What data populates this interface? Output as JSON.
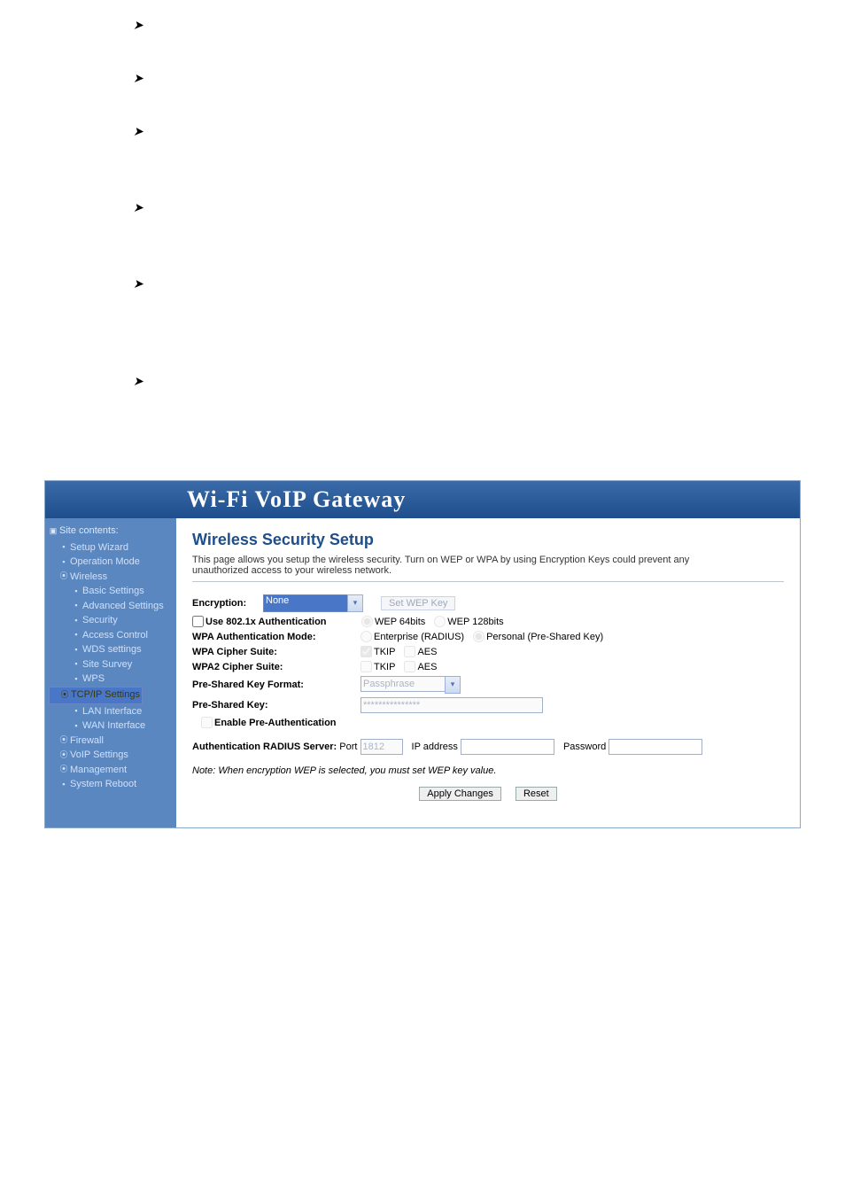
{
  "header": {
    "title": "Wi-Fi  VoIP  Gateway"
  },
  "sidebar": {
    "root": "Site contents:",
    "items": [
      {
        "label": "Setup Wizard",
        "type": "page",
        "lvl": 2
      },
      {
        "label": "Operation Mode",
        "type": "page",
        "lvl": 2
      },
      {
        "label": "Wireless",
        "type": "folder",
        "lvl": 2
      },
      {
        "label": "Basic Settings",
        "type": "page",
        "lvl": 3
      },
      {
        "label": "Advanced Settings",
        "type": "page",
        "lvl": 3
      },
      {
        "label": "Security",
        "type": "page",
        "lvl": 3
      },
      {
        "label": "Access Control",
        "type": "page",
        "lvl": 3
      },
      {
        "label": "WDS settings",
        "type": "page",
        "lvl": 3
      },
      {
        "label": "Site Survey",
        "type": "page",
        "lvl": 3
      },
      {
        "label": "WPS",
        "type": "page",
        "lvl": 3
      },
      {
        "label": "TCP/IP Settings",
        "type": "folder",
        "lvl": 2,
        "sel": true
      },
      {
        "label": "LAN Interface",
        "type": "page",
        "lvl": 3
      },
      {
        "label": "WAN Interface",
        "type": "page",
        "lvl": 3
      },
      {
        "label": "Firewall",
        "type": "folder",
        "lvl": 2
      },
      {
        "label": "VoIP Settings",
        "type": "folder",
        "lvl": 2
      },
      {
        "label": "Management",
        "type": "folder",
        "lvl": 2
      },
      {
        "label": "System Reboot",
        "type": "page",
        "lvl": 2
      }
    ]
  },
  "content": {
    "title": "Wireless Security Setup",
    "desc": "This page allows you setup the wireless security. Turn on WEP or WPA by using Encryption Keys could prevent any unauthorized access to your wireless network.",
    "encryption_label": "Encryption:",
    "encryption_value": "None",
    "set_wep_btn": "Set WEP Key",
    "use8021x_label": "Use 802.1x Authentication",
    "wep64_label": "WEP 64bits",
    "wep128_label": "WEP 128bits",
    "wpa_auth_label": "WPA Authentication Mode:",
    "enterprise_label": "Enterprise (RADIUS)",
    "personal_label": "Personal (Pre-Shared Key)",
    "wpa_cipher_label": "WPA Cipher Suite:",
    "wpa2_cipher_label": "WPA2 Cipher Suite:",
    "tkip_label": "TKIP",
    "aes_label": "AES",
    "psk_format_label": "Pre-Shared Key Format:",
    "psk_format_value": "Passphrase",
    "psk_label": "Pre-Shared Key:",
    "psk_value": "***************",
    "preauth_label": "Enable Pre-Authentication",
    "radius_label": "Authentication RADIUS Server:",
    "radius_port_label": "Port",
    "radius_port_value": "1812",
    "radius_ip_label": "IP address",
    "radius_ip_value": "",
    "radius_pw_label": "Password",
    "radius_pw_value": "",
    "note": "Note: When encryption WEP is selected, you must set WEP key value.",
    "apply_btn": "Apply Changes",
    "reset_btn": "Reset"
  }
}
